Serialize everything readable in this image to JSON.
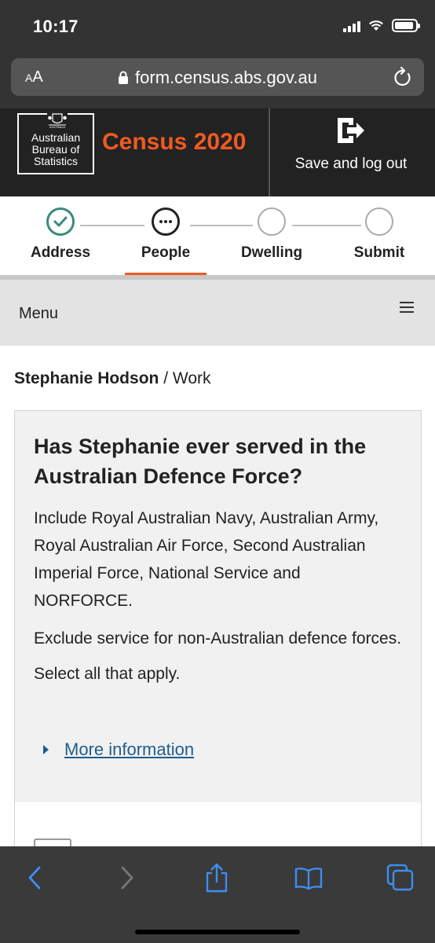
{
  "status_bar": {
    "time": "10:17"
  },
  "browser": {
    "text_size_label": "AA",
    "url": "form.census.abs.gov.au"
  },
  "header": {
    "logo_text_line1": "Australian",
    "logo_text_line2": "Bureau of",
    "logo_text_line3": "Statistics",
    "logo_crest_text": "AUSTRALIA",
    "title": "Census 2020",
    "save_logout_label": "Save and log out",
    "accent_color": "#f05a22"
  },
  "steps": [
    {
      "label": "Address",
      "state": "done"
    },
    {
      "label": "People",
      "state": "current"
    },
    {
      "label": "Dwelling",
      "state": "pending"
    },
    {
      "label": "Submit",
      "state": "pending"
    }
  ],
  "menu": {
    "label": "Menu"
  },
  "breadcrumb": {
    "person": "Stephanie Hodson",
    "separator": " / ",
    "section": "Work"
  },
  "question": {
    "title": "Has Stephanie ever served in the Australian Defence Force?",
    "include_text": "Include Royal Australian Navy, Australian Army, Royal Australian Air Force, Second Australian Imperial Force, National Service and NORFORCE.",
    "exclude_text": "Exclude service for non-Australian defence forces.",
    "instruction": "Select all that apply.",
    "more_info_label": "More information"
  },
  "toolbar": {
    "icons": [
      "back-icon",
      "forward-icon",
      "share-icon",
      "bookmarks-icon",
      "tabs-icon"
    ]
  }
}
